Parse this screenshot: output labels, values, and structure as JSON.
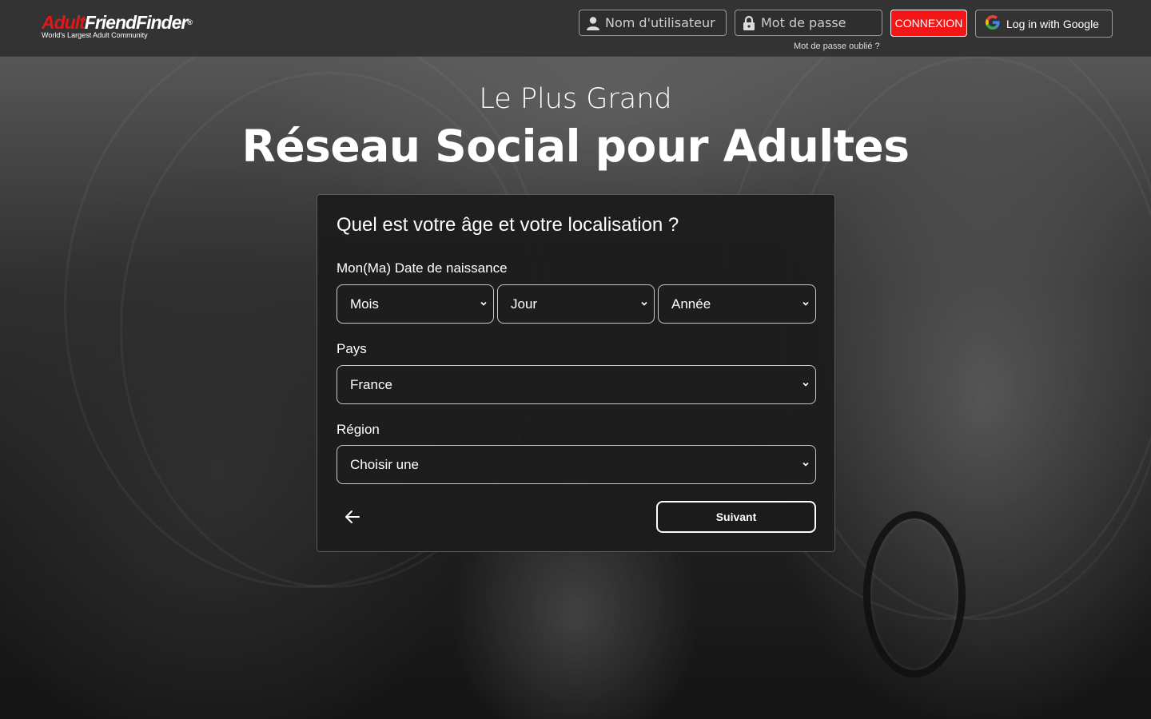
{
  "header": {
    "logo": {
      "part1": "Adult",
      "part2": "FriendFinder",
      "reg": "®",
      "tagline": "World's Largest Adult Community"
    },
    "username_placeholder": "Nom d'utilisateur",
    "password_placeholder": "Mot de passe",
    "login_label": "CONNEXION",
    "google_label": "Log in with Google",
    "forgot_label": "Mot de passe oublié ?"
  },
  "hero": {
    "subtitle": "Le Plus Grand",
    "title": "Réseau Social pour Adultes"
  },
  "form": {
    "question": "Quel est votre âge et votre localisation ?",
    "dob_label": "Mon(Ma) Date de naissance",
    "month_value": "Mois",
    "day_value": "Jour",
    "year_value": "Année",
    "country_label": "Pays",
    "country_value": "France",
    "region_label": "Région",
    "region_value": "Choisir une",
    "next_label": "Suivant"
  },
  "colors": {
    "header_bg": "#333333",
    "login_red": "#f21616",
    "logo_red": "#e01818",
    "panel_bg": "#1c1c1c"
  },
  "icons": {
    "username": "user-icon",
    "password": "lock-icon",
    "google": "google-icon",
    "back": "arrow-left-icon",
    "select": "chevron-down-icon"
  }
}
